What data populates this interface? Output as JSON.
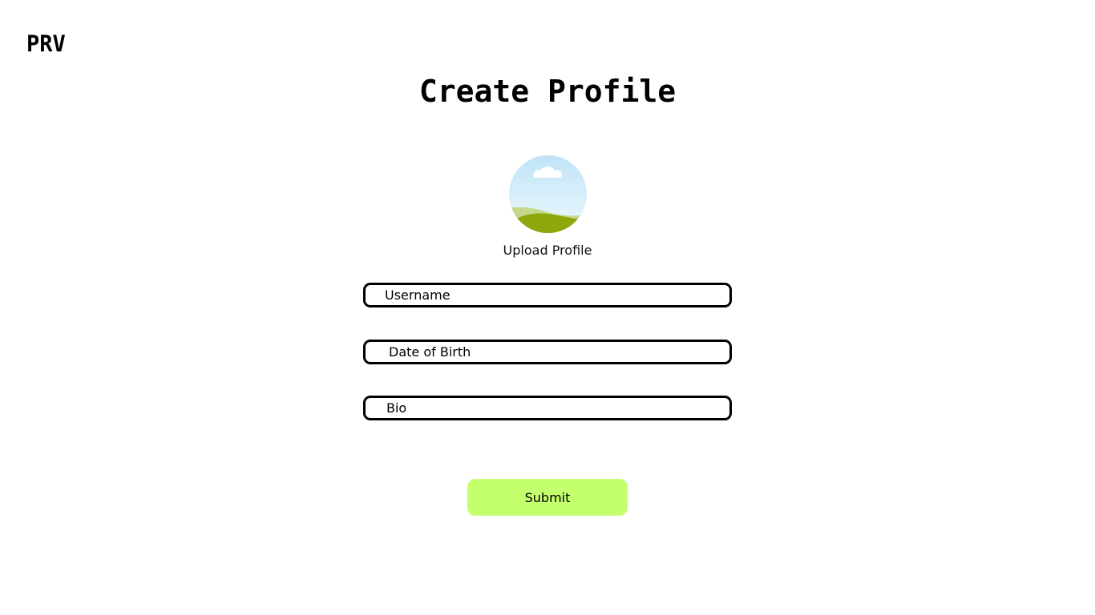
{
  "brand": {
    "logo_text": "PRV"
  },
  "page": {
    "title": "Create Profile"
  },
  "avatar": {
    "icon": "landscape-image-icon",
    "upload_label": "Upload Profile"
  },
  "form": {
    "username": {
      "placeholder": "Username",
      "value": ""
    },
    "dob": {
      "placeholder": "Date of Birth",
      "value": ""
    },
    "bio": {
      "placeholder": "Bio",
      "value": ""
    },
    "submit_label": "Submit"
  },
  "colors": {
    "background": "#ffffff",
    "submit_button": "#c4ff6e",
    "field_border": "#000000",
    "sky_top": "#bfe3f7",
    "sky_bottom": "#e8f6fc",
    "hill_light": "#c3d88a",
    "hill_dark": "#8ea80a"
  }
}
